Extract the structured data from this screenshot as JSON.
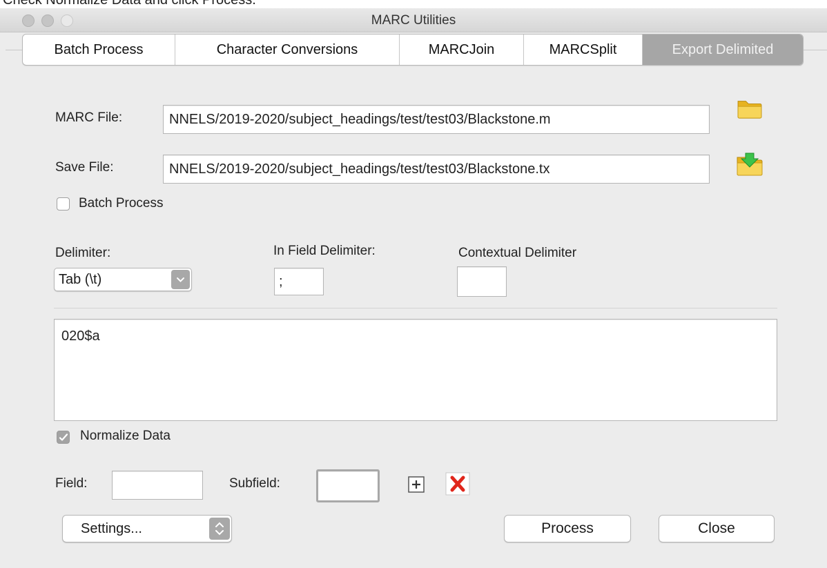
{
  "caption": "Check Normalize Data and click Process.",
  "window": {
    "title": "MARC Utilities"
  },
  "tabs": [
    {
      "label": "Batch Process",
      "active": false
    },
    {
      "label": "Character Conversions",
      "active": false
    },
    {
      "label": "MARCJoin",
      "active": false
    },
    {
      "label": "MARCSplit",
      "active": false
    },
    {
      "label": "Export Delimited",
      "active": true
    }
  ],
  "form": {
    "marc_file": {
      "label": "MARC File:",
      "value": "NNELS/2019-2020/subject_headings/test/test03/Blackstone.m",
      "icon": "open-folder-icon"
    },
    "save_file": {
      "label": "Save File:",
      "value": "NNELS/2019-2020/subject_headings/test/test03/Blackstone.tx",
      "icon": "save-folder-icon"
    },
    "batch_process": {
      "label": "Batch Process",
      "checked": false
    },
    "delimiter": {
      "label": "Delimiter:",
      "value": "Tab (\\t)"
    },
    "in_field_delimiter": {
      "label": "In Field Delimiter:",
      "value": ";"
    },
    "contextual_delimiter": {
      "label": "Contextual Delimiter",
      "value": ""
    },
    "fields_list": "020$a",
    "normalize_data": {
      "label": "Normalize Data",
      "checked": true
    },
    "field": {
      "label": "Field:",
      "value": ""
    },
    "subfield": {
      "label": "Subfield:",
      "value": ""
    }
  },
  "buttons": {
    "settings": "Settings...",
    "process": "Process",
    "close": "Close"
  },
  "colors": {
    "active_tab": "#a6a6a6",
    "delete_icon": "#e0261b",
    "folder": "#f0c53a",
    "save_arrow": "#3cc24a"
  }
}
